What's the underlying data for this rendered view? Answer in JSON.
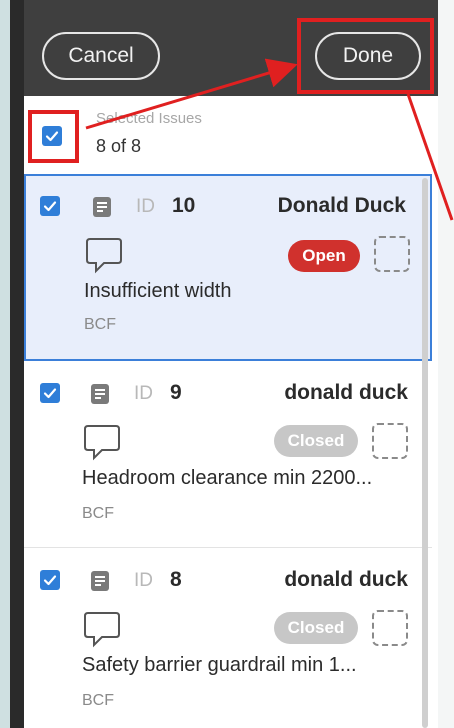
{
  "toolbar": {
    "cancel_label": "Cancel",
    "done_label": "Done"
  },
  "selection": {
    "caption": "Selected Issues",
    "count": "8 of 8"
  },
  "issues": [
    {
      "id_label": "ID",
      "id": "10",
      "owner": "Donald Duck",
      "status": "Open",
      "title": "Insufficient width",
      "source": "BCF",
      "selected": true
    },
    {
      "id_label": "ID",
      "id": "9",
      "owner": "donald duck",
      "status": "Closed",
      "title": "Headroom clearance min 2200...",
      "source": "BCF",
      "selected": false
    },
    {
      "id_label": "ID",
      "id": "8",
      "owner": "donald duck",
      "status": "Closed",
      "title": "Safety barrier guardrail min 1...",
      "source": "BCF",
      "selected": false
    }
  ],
  "icons": {
    "checkbox": "checkbox-checked-icon",
    "document": "document-icon",
    "comment": "comment-icon",
    "placeholder": "dashed-square-icon"
  },
  "colors": {
    "accent": "#2f7ed8",
    "status_open": "#d0312d",
    "status_closed": "#c7c7c7",
    "highlight": "#e02020",
    "topbar": "#3f3f3f"
  }
}
